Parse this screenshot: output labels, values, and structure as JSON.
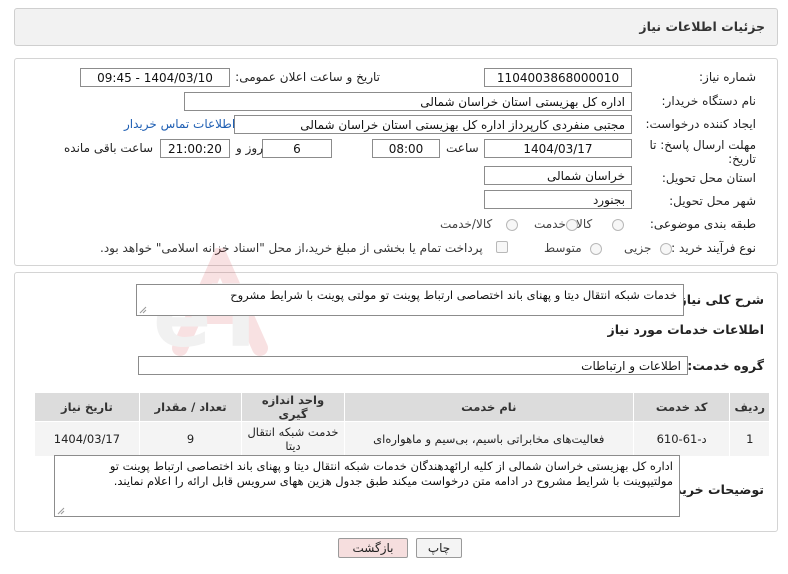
{
  "header": {
    "title": "جزئیات اطلاعات نیاز"
  },
  "form": {
    "need_number": {
      "label": "شماره نیاز:",
      "value": "1104003868000010"
    },
    "announce_datetime": {
      "label": "تاریخ و ساعت اعلان عمومی:",
      "value": "1404/03/10 - 09:45"
    },
    "buyer_org": {
      "label": "نام دستگاه خریدار:",
      "value": "اداره کل بهزیستی استان خراسان شمالی"
    },
    "requester": {
      "label": "ایجاد کننده درخواست:",
      "value": "مجتبی منفردی کارپرداز اداره کل بهزیستی استان خراسان شمالی",
      "contact_link": "اطلاعات تماس خریدار"
    },
    "deadline": {
      "label_line1": "مهلت ارسال پاسخ: تا",
      "label_line2": "تاریخ:",
      "date": "1404/03/17",
      "time_label": "ساعت",
      "time": "08:00",
      "days": "6",
      "days_label": "روز و",
      "remaining": "21:00:20",
      "remaining_label": "ساعت باقی مانده"
    },
    "province": {
      "label": "استان محل تحویل:",
      "value": "خراسان شمالی"
    },
    "city": {
      "label": "شهر محل تحویل:",
      "value": "بجنورد"
    },
    "category": {
      "label": "طبقه بندی موضوعی:",
      "options": [
        "کالا",
        "خدمت",
        "کالا/خدمت"
      ]
    },
    "process_type": {
      "label": "نوع فرآیند خرید :",
      "options": [
        "جزیی",
        "متوسط"
      ],
      "payment_note": "پرداخت تمام یا بخشی از مبلغ خرید،از محل \"اسناد خزانه اسلامی\" خواهد بود."
    }
  },
  "summary": {
    "label": "شرح کلی نیاز:",
    "value": "خدمات شبکه انتقال دیتا و پهنای باند اختصاصی ارتباط پوینت تو مولتی پوینت با شرایط مشروح"
  },
  "services_info": {
    "title": "اطلاعات خدمات مورد نیاز",
    "group_label": "گروه خدمت:",
    "group_value": "اطلاعات و ارتباطات"
  },
  "table": {
    "headers": [
      "ردیف",
      "کد خدمت",
      "نام خدمت",
      "واحد اندازه گیری",
      "تعداد / مقدار",
      "تاریخ نیاز"
    ],
    "rows": [
      [
        "1",
        "د-61-610",
        "فعالیت‌های مخابراتی باسیم، بی‌سیم و ماهواره‌ای",
        "خدمت شبکه انتقال دیتا",
        "9",
        "1404/03/17"
      ]
    ]
  },
  "buyer_notes": {
    "label": "توضیحات خریدار:",
    "value": "اداره کل بهزیستی خراسان شمالی از کلیه ارائهدهندگان خدمات شبکه انتقال دیتا و پهنای باند اختصاصی ارتباط پوینت تو مولتیپوینت با شرایط مشروح در ادامه متن درخواست میکند طبق جدول هزین ههای سرویس قابل ارائه را اعلام نمایند."
  },
  "buttons": {
    "print": "چاپ",
    "back": "بازگشت"
  },
  "watermark": {
    "text": "AriaTender.neT"
  },
  "colors": {
    "link": "#1f5fb3",
    "back_button": "#f6dede",
    "header_bg": "#f2f2f2"
  }
}
